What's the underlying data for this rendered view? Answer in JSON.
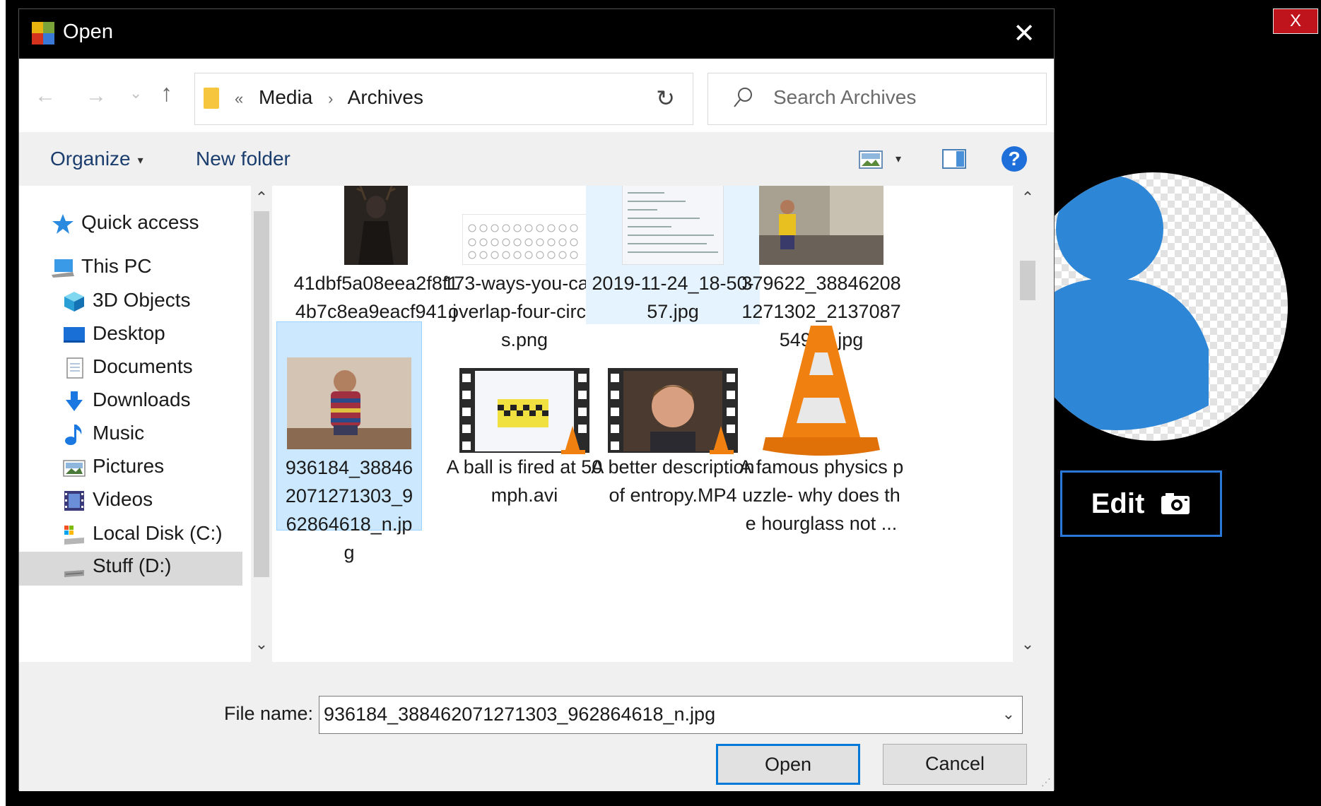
{
  "dialog": {
    "title": "Open",
    "close_label": "✕"
  },
  "nav": {
    "back": "←",
    "forward": "→",
    "recent": "⌄",
    "up": "↑",
    "breadcrumb_overflow": "«",
    "breadcrumbs": [
      "Media",
      "Archives"
    ],
    "breadcrumb_sep": "›",
    "dropdown": "⌄",
    "refresh": "↻"
  },
  "search": {
    "placeholder": "Search Archives"
  },
  "toolbar": {
    "organize": "Organize",
    "organize_caret": "▾",
    "new_folder": "New folder",
    "view_caret": "▾",
    "help": "?"
  },
  "sidebar": {
    "items": [
      {
        "label": "Quick access",
        "icon": "star-icon"
      },
      {
        "label": "This PC",
        "icon": "computer-icon"
      },
      {
        "label": "3D Objects",
        "icon": "cube-icon"
      },
      {
        "label": "Desktop",
        "icon": "desktop-icon"
      },
      {
        "label": "Documents",
        "icon": "document-icon"
      },
      {
        "label": "Downloads",
        "icon": "download-icon"
      },
      {
        "label": "Music",
        "icon": "music-icon"
      },
      {
        "label": "Pictures",
        "icon": "pictures-icon"
      },
      {
        "label": "Videos",
        "icon": "video-icon"
      },
      {
        "label": "Local Disk (C:)",
        "icon": "drive-icon"
      },
      {
        "label": "Stuff (D:)",
        "icon": "drive-icon"
      }
    ],
    "scroll_up": "⌃",
    "scroll_down": "⌄"
  },
  "files": {
    "items": [
      {
        "name": "41dbf5a08eea2f8f14b7c8ea9eacf941.jpg",
        "icon": "image-thumbnail-icon"
      },
      {
        "name": "173-ways-you-can-overlap-four-circles.png",
        "icon": "image-thumbnail-icon"
      },
      {
        "name": "2019-11-24_18-50-57.jpg",
        "icon": "image-thumbnail-icon"
      },
      {
        "name": "379622_388462081271302_2137087549_n.jpg",
        "icon": "image-thumbnail-icon"
      },
      {
        "name": "936184_388462071271303_962864618_n.jpg",
        "icon": "image-thumbnail-icon"
      },
      {
        "name": "A ball is fired at 50mph.avi",
        "icon": "video-thumbnail-icon"
      },
      {
        "name": "A better description of entropy.MP4",
        "icon": "video-thumbnail-icon"
      },
      {
        "name": "A famous physics puzzle- why does the hourglass not ...",
        "icon": "vlc-cone-icon"
      }
    ],
    "scroll_up": "⌃",
    "scroll_down": "⌄"
  },
  "bottom": {
    "file_name_label": "File name:",
    "file_name_value": "936184_388462071271303_962864618_n.jpg",
    "dropdown": "⌄",
    "open_label": "Open",
    "cancel_label": "Cancel"
  },
  "right_panel": {
    "edit_label": "Edit",
    "close_label": "X"
  },
  "colors": {
    "accent": "#0078d7",
    "selection": "#cce8ff",
    "avatar_blue": "#2e86d6"
  }
}
